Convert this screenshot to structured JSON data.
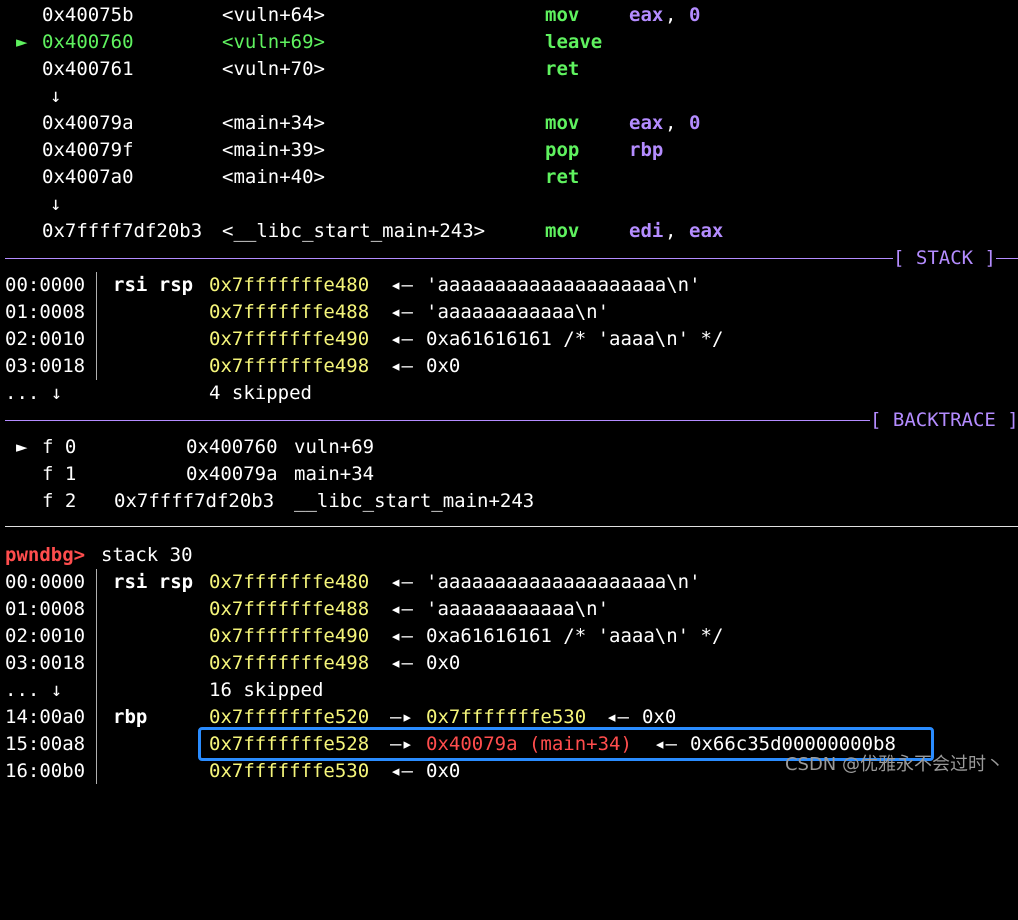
{
  "disasm": [
    {
      "marker": "",
      "addr": "0x40075b",
      "sym": "<vuln+64>",
      "op": "mov",
      "a1": "eax",
      "sep": ",",
      "a2": "0",
      "current": false
    },
    {
      "marker": "►",
      "addr": "0x400760",
      "sym": "<vuln+69>",
      "op": "leave",
      "a1": "",
      "sep": "",
      "a2": "",
      "current": true
    },
    {
      "marker": "",
      "addr": "0x400761",
      "sym": "<vuln+70>",
      "op": "ret",
      "a1": "",
      "sep": "",
      "a2": "",
      "current": false
    },
    {
      "arrow": "↓"
    },
    {
      "marker": "",
      "addr": "0x40079a",
      "sym": "<main+34>",
      "op": "mov",
      "a1": "eax",
      "sep": ",",
      "a2": "0",
      "current": false
    },
    {
      "marker": "",
      "addr": "0x40079f",
      "sym": "<main+39>",
      "op": "pop",
      "a1": "rbp",
      "sep": "",
      "a2": "",
      "current": false
    },
    {
      "marker": "",
      "addr": "0x4007a0",
      "sym": "<main+40>",
      "op": "ret",
      "a1": "",
      "sep": "",
      "a2": "",
      "current": false
    },
    {
      "arrow": "↓"
    },
    {
      "marker": "",
      "addr": "0x7ffff7df20b3",
      "sym": "<__libc_start_main+243>",
      "op": "mov",
      "a1": "edi",
      "sep": ",",
      "a2": "eax",
      "current": false
    }
  ],
  "stack_header": "[ STACK ]",
  "stack": [
    {
      "off": "00:0000",
      "reg": "rsi rsp",
      "addr": "0x7fffffffe480",
      "arrow": "◂—",
      "val": "'aaaaaaaaaaaaaaaaaaaa\\n'"
    },
    {
      "off": "01:0008",
      "reg": "",
      "addr": "0x7fffffffe488",
      "arrow": "◂—",
      "val": "'aaaaaaaaaaaa\\n'"
    },
    {
      "off": "02:0010",
      "reg": "",
      "addr": "0x7fffffffe490",
      "arrow": "◂—",
      "val": "0xa61616161 /* 'aaaa\\n' */"
    },
    {
      "off": "03:0018",
      "reg": "",
      "addr": "0x7fffffffe498",
      "arrow": "◂—",
      "val": "0x0"
    }
  ],
  "stack_skip": {
    "dots": "... ↓",
    "text": "4 skipped"
  },
  "backtrace_header": "[ BACKTRACE ]",
  "backtrace": [
    {
      "marker": "►",
      "frame": "f 0",
      "addr": "0x400760",
      "sym": "vuln+69"
    },
    {
      "marker": "",
      "frame": "f 1",
      "addr": "0x40079a",
      "sym": "main+34"
    },
    {
      "marker": "",
      "frame": "f 2",
      "addr": "0x7ffff7df20b3",
      "sym": "__libc_start_main+243"
    }
  ],
  "prompt": {
    "label": "pwndbg>",
    "command": "stack 30"
  },
  "stack30": [
    {
      "off": "00:0000",
      "reg": "rsi rsp",
      "addr": "0x7fffffffe480",
      "arrow": "◂—",
      "val": "'aaaaaaaaaaaaaaaaaaaa\\n'"
    },
    {
      "off": "01:0008",
      "reg": "",
      "addr": "0x7fffffffe488",
      "arrow": "◂—",
      "val": "'aaaaaaaaaaaa\\n'"
    },
    {
      "off": "02:0010",
      "reg": "",
      "addr": "0x7fffffffe490",
      "arrow": "◂—",
      "val": "0xa61616161 /* 'aaaa\\n' */"
    },
    {
      "off": "03:0018",
      "reg": "",
      "addr": "0x7fffffffe498",
      "arrow": "◂—",
      "val": "0x0"
    }
  ],
  "stack30_skip": {
    "dots": "... ↓",
    "text": "16 skipped"
  },
  "stack30_tail": [
    {
      "off": "14:00a0",
      "reg": "rbp",
      "addr": "0x7fffffffe520",
      "arrow1": "—▸",
      "ptr": "0x7fffffffe530",
      "arrow2": "◂—",
      "val": "0x0"
    },
    {
      "off": "15:00a8",
      "reg": "",
      "addr": "0x7fffffffe528",
      "arrow1": "—▸",
      "ptr": "0x40079a (main+34)",
      "arrow2": "◂—",
      "val": "0x66c35d00000000b8"
    },
    {
      "off": "16:00b0",
      "reg": "",
      "addr": "0x7fffffffe530",
      "arrow1": "",
      "ptr": "",
      "arrow2": "◂—",
      "val": "0x0"
    }
  ],
  "watermark": "CSDN @优雅永不会过时丶",
  "colors": {
    "accent_purple": "#b48cff",
    "green": "#5ff25f",
    "yellow": "#f5f57a",
    "red": "#ff4d4d",
    "highlight_box": "#2a8cff"
  }
}
